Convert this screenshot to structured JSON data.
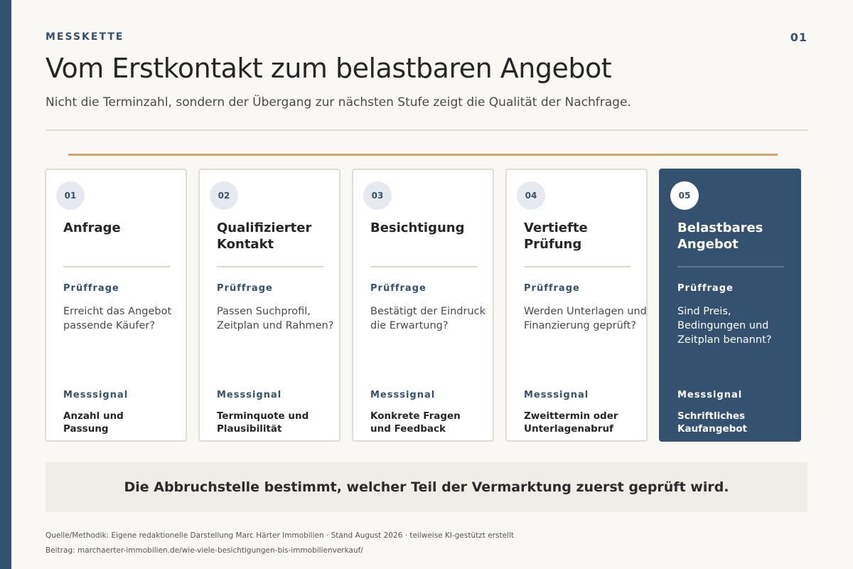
{
  "header": {
    "kicker": "MESSKETTE",
    "page_number": "01",
    "title": "Vom Erstkontakt zum belastbaren Angebot",
    "subtitle": "Nicht die Terminzahl, sondern der Übergang zur nächsten Stufe zeigt die Qualität der Nachfrage."
  },
  "colors": {
    "accent": "#34516f",
    "gold": "#c9a96a",
    "background": "#f9f8f5"
  },
  "stages": [
    {
      "number": "01",
      "title": "Anfrage",
      "question_label": "Prüffrage",
      "question": "Erreicht das Angebot passende Käufer?",
      "signal_label": "Messsignal",
      "signal": "Anzahl und Passung"
    },
    {
      "number": "02",
      "title": "Qualifizierter Kontakt",
      "question_label": "Prüffrage",
      "question": "Passen Suchprofil, Zeitplan und Rahmen?",
      "signal_label": "Messsignal",
      "signal": "Terminquote und Plausibilität"
    },
    {
      "number": "03",
      "title": "Besichtigung",
      "question_label": "Prüffrage",
      "question": "Bestätigt der Eindruck die Erwartung?",
      "signal_label": "Messsignal",
      "signal": "Konkrete Fragen und Feedback"
    },
    {
      "number": "04",
      "title": "Vertiefte Prüfung",
      "question_label": "Prüffrage",
      "question": "Werden Unterlagen und Finanzierung geprüft?",
      "signal_label": "Messsignal",
      "signal": "Zweittermin oder Unterlagenabruf"
    },
    {
      "number": "05",
      "title": "Belastbares Angebot",
      "question_label": "Prüffrage",
      "question": "Sind Preis, Bedingungen und Zeitplan benannt?",
      "signal_label": "Messsignal",
      "signal": "Schriftliches Kaufangebot"
    }
  ],
  "callout": "Die Abbruchstelle bestimmt, welcher Teil der Vermarktung zuerst geprüft wird.",
  "footer": {
    "source": "Quelle/Methodik: Eigene redaktionelle Darstellung Marc Härter Immobilien · Stand August 2026 · teilweise KI-gestützt erstellt",
    "link": "Beitrag: marchaerter-immobilien.de/wie-viele-besichtigungen-bis-immobilienverkauf/"
  }
}
